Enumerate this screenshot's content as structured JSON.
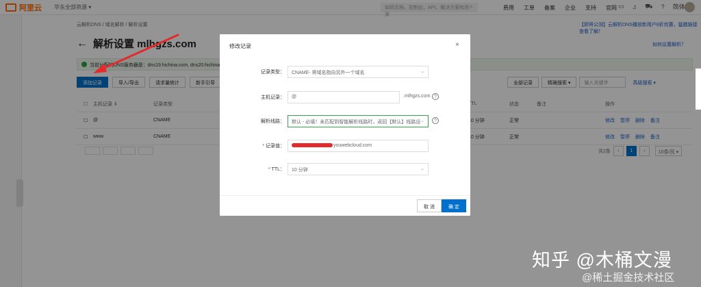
{
  "topbar": {
    "logo": "阿里云",
    "region": "华东全部资源 ▾",
    "search_placeholder": "如同文档、控制台、API、解决方案和资源",
    "nav": [
      "费用",
      "工单",
      "备案",
      "企业",
      "支持",
      "官网"
    ],
    "lang": "简体"
  },
  "breadcrumb": "云解析DNS  /  域名解析  /  解析设置",
  "notice": "【即将公测】云解析DNS播放新用户8折优惠，猛戳链接查看了解！",
  "page": {
    "title": "解析设置 mlhgzs.com",
    "help_link": "如何设置解析？",
    "dns_info": "当前分配的DNS服务器是：dns19.hichina.com, dns20.hichina.com"
  },
  "toolbar": {
    "add": "添加记录",
    "import": "导入/导出",
    "stats": "请求量统计",
    "guide": "新手引导",
    "all_records": "全部记录",
    "exact_search": "精确搜索 ▾",
    "keyword_placeholder": "输入关键字",
    "advanced": "高级搜索 ▾"
  },
  "table": {
    "headers": [
      "主机记录 ⇕",
      "记录类型",
      "TTL",
      "状态",
      "备注",
      "操作"
    ],
    "rows": [
      {
        "host": "@",
        "type": "CNAME",
        "ttl": "10 分钟",
        "status": "正常",
        "ops": [
          "修改",
          "暂停",
          "删除",
          "备注"
        ]
      },
      {
        "host": "www",
        "type": "CNAME",
        "ttl": "10 分钟",
        "status": "正常",
        "ops": [
          "修改",
          "暂停",
          "删除",
          "备注"
        ]
      }
    ]
  },
  "pager": {
    "total": "共2条",
    "current": "1",
    "size": "10条/页 ▾"
  },
  "modal": {
    "title": "修改记录",
    "close": "×",
    "type_label": "记录类型：",
    "type_value": "CNAME- 将域名指向另外一个域名",
    "host_label": "主机记录：",
    "host_value": "@",
    "host_suffix": ".mlhgzs.com",
    "line_label": "解析线路：",
    "line_value": "默认 - 必填！未匹配到智能解析线路时，返回【默认】线路设...",
    "value_label": "记录值：",
    "value_text": "youwebcloud.com",
    "ttl_label": "TTL：",
    "ttl_value": "10 分钟",
    "cancel": "取 消",
    "confirm": "确 定"
  },
  "watermark": {
    "main": "知乎 @木桶文漫",
    "sub": "@稀土掘金技术社区"
  },
  "colors": {
    "primary": "#0070cc",
    "brand": "#ff6a00",
    "required": "#e12b2b",
    "arrow": "#e32b2b"
  }
}
